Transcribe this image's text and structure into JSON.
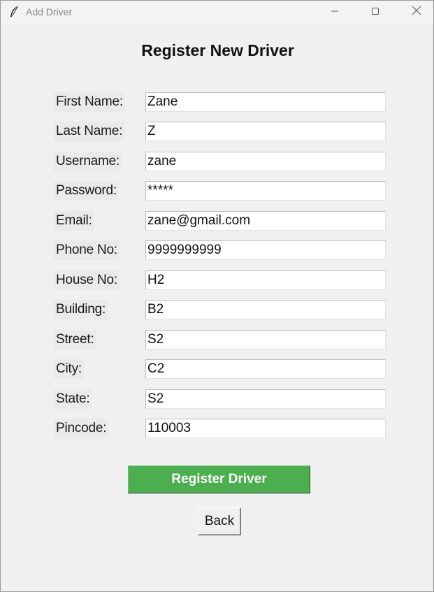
{
  "window": {
    "title": "Add Driver",
    "icon": "feather-icon",
    "controls": {
      "minimize_icon": "minimize-icon",
      "maximize_icon": "maximize-icon",
      "close_icon": "close-icon"
    }
  },
  "form": {
    "heading": "Register New Driver",
    "fields": [
      {
        "label": "First Name:",
        "value": "Zane"
      },
      {
        "label": "Last Name:",
        "value": "Z"
      },
      {
        "label": "Username:",
        "value": "zane"
      },
      {
        "label": "Password:",
        "value": "*****"
      },
      {
        "label": "Email:",
        "value": "zane@gmail.com"
      },
      {
        "label": "Phone No:",
        "value": "9999999999"
      },
      {
        "label": "House No:",
        "value": "H2"
      },
      {
        "label": "Building:",
        "value": "B2"
      },
      {
        "label": "Street:",
        "value": "S2"
      },
      {
        "label": "City:",
        "value": "C2"
      },
      {
        "label": "State:",
        "value": "S2"
      },
      {
        "label": "Pincode:",
        "value": "110003"
      }
    ],
    "register_button": "Register Driver",
    "back_button": "Back"
  },
  "colors": {
    "register_button_bg": "#4cae4f",
    "register_button_text": "#ffffff",
    "window_bg": "#f0f0f0"
  }
}
